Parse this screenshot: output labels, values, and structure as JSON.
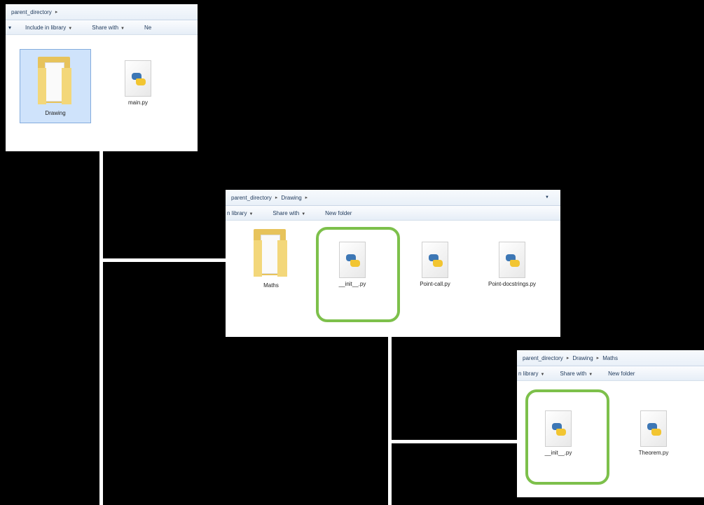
{
  "window1": {
    "address": {
      "crumbs": [
        "parent_directory"
      ]
    },
    "toolbar": {
      "items": [
        "Include in library",
        "Share with",
        "Ne"
      ]
    },
    "files": [
      {
        "name": "Drawing",
        "kind": "folder-icon"
      },
      {
        "name": "main.py",
        "kind": "python-file-icon"
      }
    ]
  },
  "window2": {
    "address": {
      "crumbs": [
        "parent_directory",
        "Drawing"
      ]
    },
    "toolbar": {
      "items": [
        "n library",
        "Share with",
        "New folder"
      ]
    },
    "files": [
      {
        "name": "Maths",
        "kind": "folder-icon"
      },
      {
        "name": "__init__.py",
        "kind": "python-file-icon"
      },
      {
        "name": "Point-call.py",
        "kind": "python-file-icon"
      },
      {
        "name": "Point-docstrings.py",
        "kind": "python-file-icon"
      }
    ]
  },
  "window3": {
    "address": {
      "crumbs": [
        "parent_directory",
        "Drawing",
        "Maths"
      ]
    },
    "toolbar": {
      "items": [
        "n library",
        "Share with",
        "New folder"
      ]
    },
    "files": [
      {
        "name": "__init__.py",
        "kind": "python-file-icon"
      },
      {
        "name": "Theorem.py",
        "kind": "python-file-icon"
      }
    ]
  },
  "colors": {
    "highlight": "#7dc04b",
    "connector": "#ffffff",
    "background": "#000000"
  }
}
